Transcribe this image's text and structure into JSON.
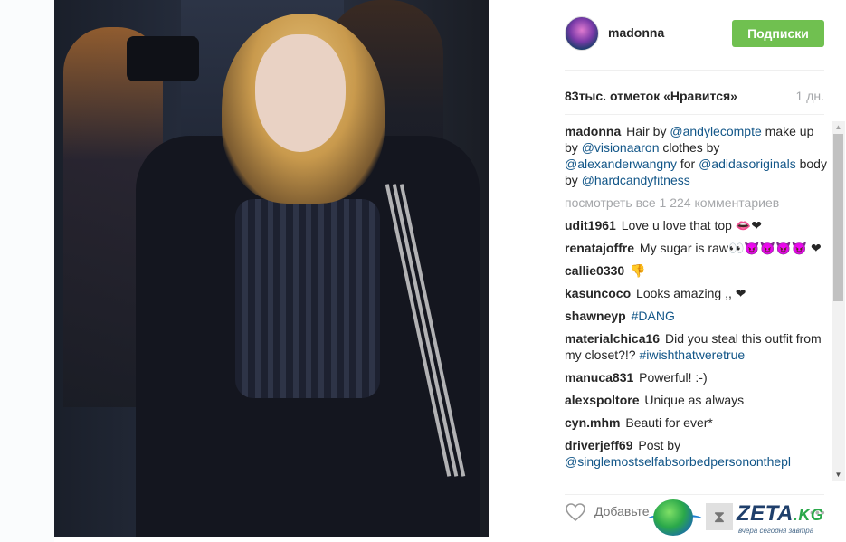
{
  "post": {
    "username": "madonna",
    "follow_label": "Подписки",
    "likes": "83тыс. отметок «Нравится»",
    "time": "1 дн."
  },
  "caption": {
    "user": "madonna",
    "t1": "Hair by",
    "m1": "@andylecompte",
    "t2": "make up by",
    "m2": "@visionaaron",
    "t3": "clothes by",
    "m3": "@alexanderwangny",
    "t4": "for",
    "m4": "@adidasoriginals",
    "t5": "body by",
    "m5": "@hardcandyfitness"
  },
  "view_all": "посмотреть все 1 224 комментариев",
  "comments": [
    {
      "user": "udit1961",
      "text": "Love u love that top 👄❤"
    },
    {
      "user": "renatajoffre",
      "text": "My sugar is raw👀😈😈😈😈 ❤"
    },
    {
      "user": "callie0330",
      "text": "👎"
    },
    {
      "user": "kasuncoco",
      "text": "Looks amazing ,, ❤"
    },
    {
      "user": "shawneyp",
      "text": "",
      "tag": "#DANG"
    },
    {
      "user": "materialchica16",
      "text": "Did you steal this outfit from my closet?!?",
      "tag": "#iwishthatweretrue"
    },
    {
      "user": "manuca831",
      "text": "Powerful! :-)"
    },
    {
      "user": "alexspoltore",
      "text": "Unique as always"
    },
    {
      "user": "cyn.mhm",
      "text": "Beauti for ever*"
    },
    {
      "user": "driverjeff69",
      "text": "Post by",
      "tag": "@singlemostselfabsorbedpersononthepl"
    }
  ],
  "comment_placeholder": "Добавьте",
  "more_label": "•••",
  "watermark": {
    "name": "ZETA",
    "tld": ".KG",
    "tagline": "вчера сегодня завтра"
  },
  "colors": {
    "follow_bg": "#70c050",
    "link": "#125688",
    "muted": "#a5a7aa"
  },
  "icons": [
    "heart-icon",
    "scroll-up-icon",
    "scroll-down-icon",
    "globe-icon",
    "hourglass-icon"
  ]
}
